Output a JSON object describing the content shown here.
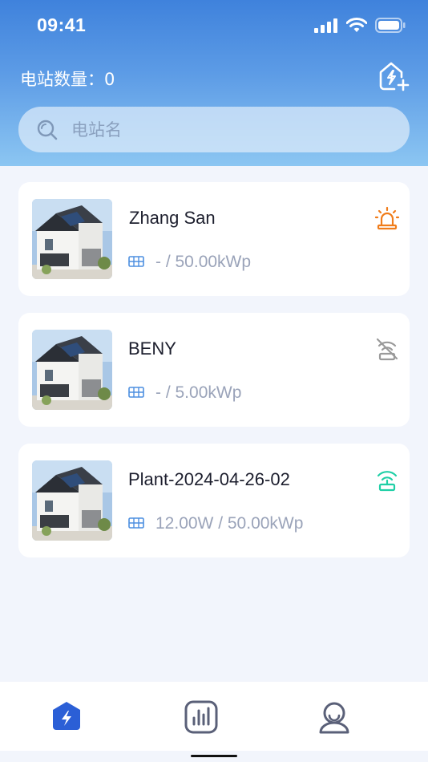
{
  "status_bar": {
    "time": "09:41"
  },
  "header": {
    "count_label": "电站数量：0"
  },
  "search": {
    "placeholder": "电站名",
    "value": ""
  },
  "stations": [
    {
      "name": "Zhang San",
      "power": "- / 50.00kWp",
      "state_icon": "alarm-icon",
      "state_color": "#f07c1a"
    },
    {
      "name": "BENY",
      "power": "- / 5.00kWp",
      "state_icon": "offline-icon",
      "state_color": "#9a9a9a"
    },
    {
      "name": "Plant-2024-04-26-02",
      "power": "12.00W / 50.00kWp",
      "state_icon": "online-icon",
      "state_color": "#1fcfa6"
    }
  ],
  "tabs": [
    {
      "name": "power-station-tab",
      "icon": "lightning-icon",
      "active": true
    },
    {
      "name": "statistics-tab",
      "icon": "bar-chart-icon",
      "active": false
    },
    {
      "name": "profile-tab",
      "icon": "user-icon",
      "active": false
    }
  ],
  "colors": {
    "accent": "#2b5fd6",
    "inactive_icon": "#5a6078",
    "header_top": "#3f82dc",
    "header_bottom": "#8cc6f2"
  }
}
